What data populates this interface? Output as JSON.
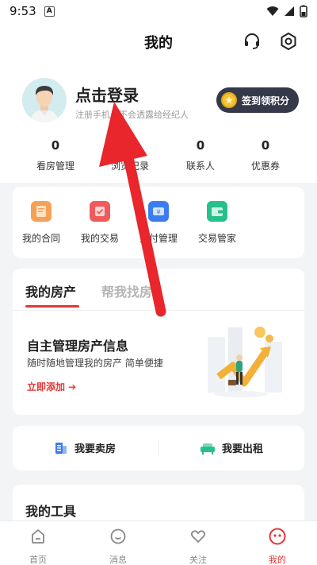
{
  "status_bar": {
    "time": "9:53",
    "app_badge": "A"
  },
  "header": {
    "title": "我的"
  },
  "profile": {
    "login_title": "点击登录",
    "login_subtitle": "注册手机号不会透露给经纪人",
    "sign_button": "签到领积分"
  },
  "stats": [
    {
      "value": "0",
      "label": "看房管理"
    },
    {
      "value": "0",
      "label": "浏览记录"
    },
    {
      "value": "0",
      "label": "联系人"
    },
    {
      "value": "0",
      "label": "优惠券"
    }
  ],
  "services": [
    {
      "label": "我的合同",
      "color": "#f6a055",
      "icon": "contract-icon"
    },
    {
      "label": "我的交易",
      "color": "#f15a5a",
      "icon": "trade-icon"
    },
    {
      "label": "支付管理",
      "color": "#3c7cf0",
      "icon": "payment-icon"
    },
    {
      "label": "交易管家",
      "color": "#27c08c",
      "icon": "wallet-icon"
    }
  ],
  "property": {
    "tabs": [
      "我的房产",
      "帮我找房"
    ],
    "active_tab": 0,
    "title": "自主管理房产信息",
    "subtitle": "随时随地管理我的房产 简单便捷",
    "link": "立即添加 ➔"
  },
  "sell_rent": {
    "sell_label": "我要卖房",
    "rent_label": "我要出租"
  },
  "tools": {
    "title": "我的工具"
  },
  "bottom_nav": [
    {
      "label": "首页",
      "icon": "home-icon"
    },
    {
      "label": "消息",
      "icon": "message-icon"
    },
    {
      "label": "关注",
      "icon": "heart-icon"
    },
    {
      "label": "我的",
      "icon": "profile-icon",
      "active": true
    }
  ],
  "colors": {
    "accent": "#e43636",
    "sign_button_bg": "#35394a",
    "coin": "#f7c332",
    "arrow": "#e8262b"
  }
}
